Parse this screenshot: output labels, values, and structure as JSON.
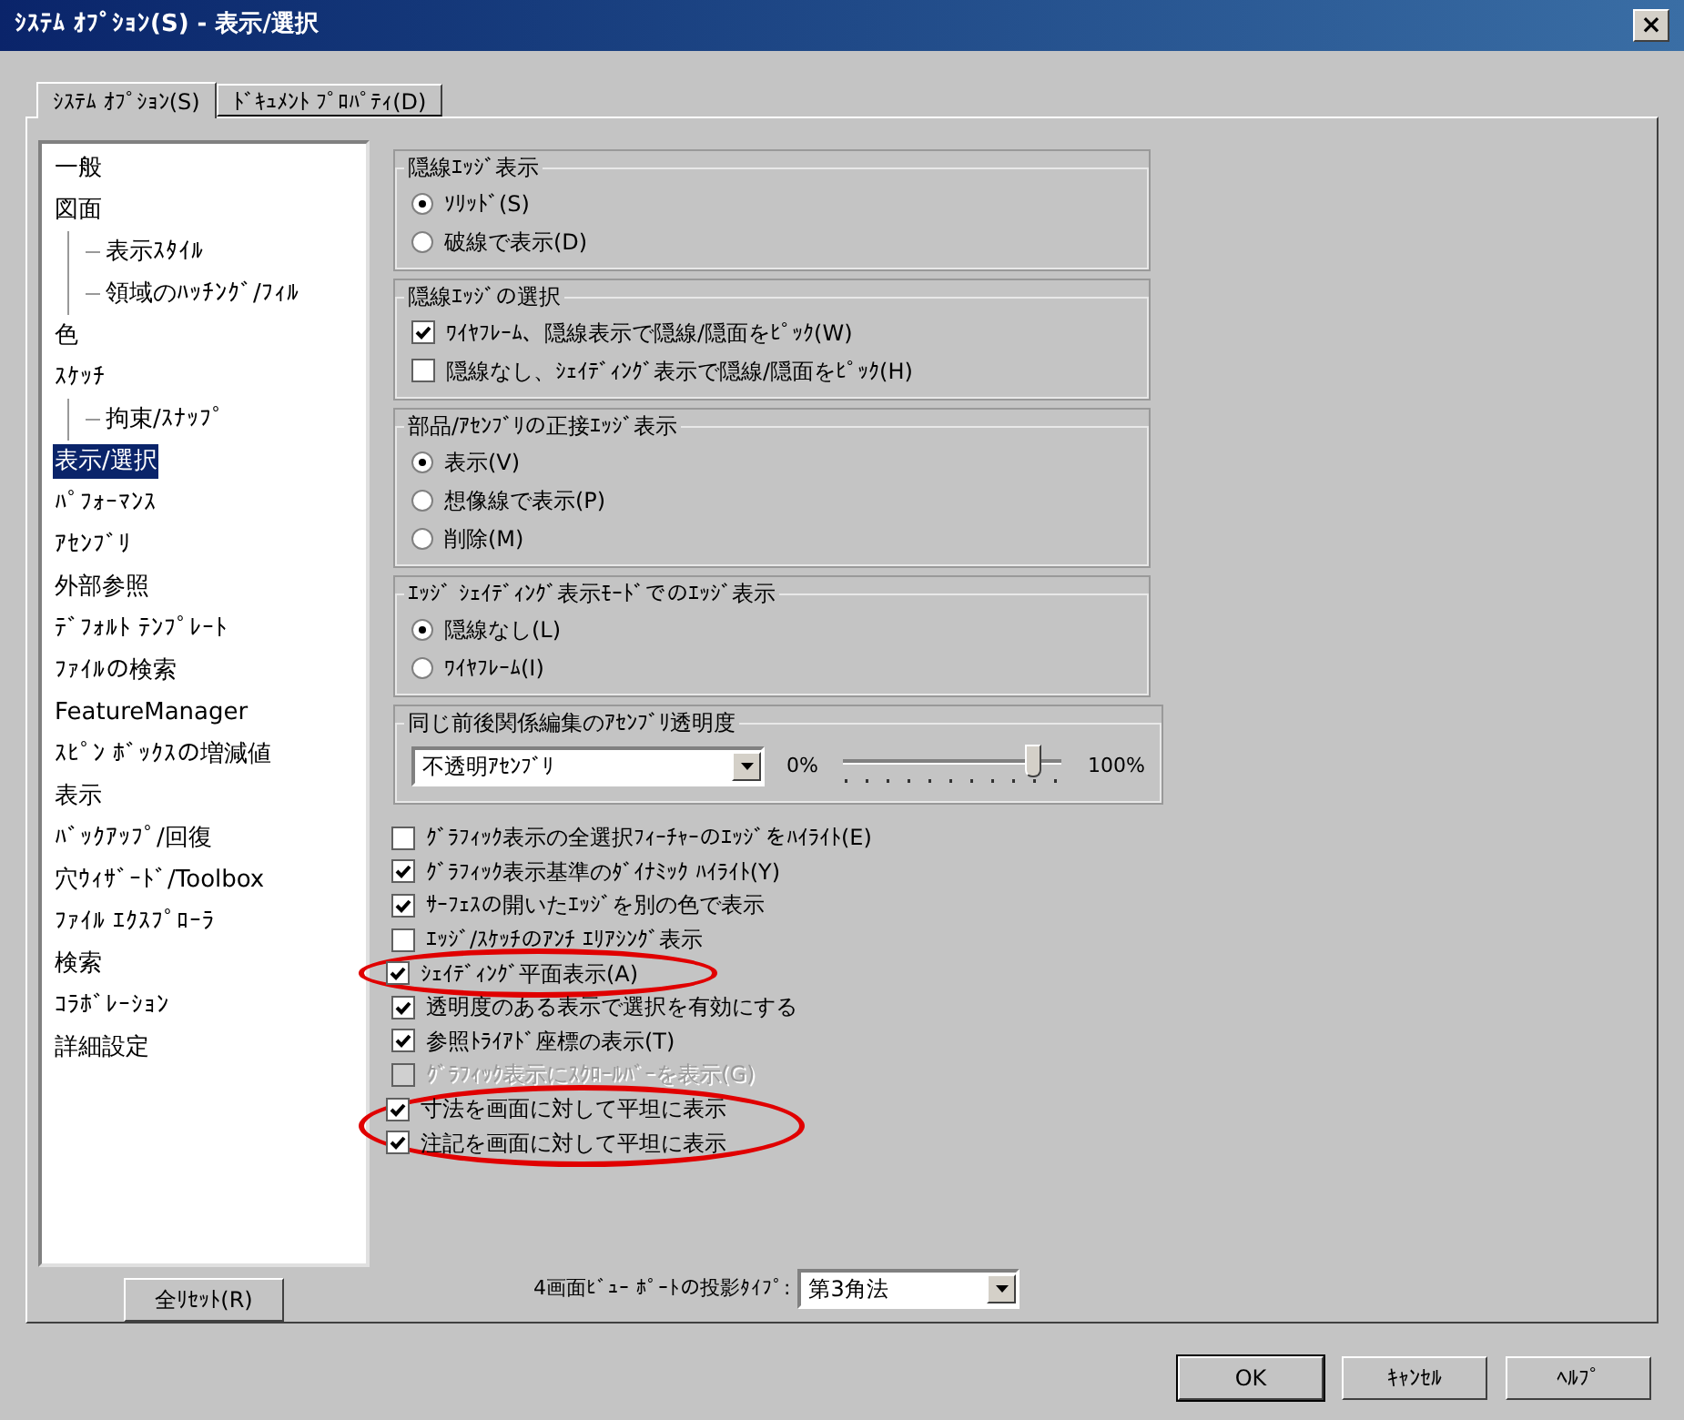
{
  "window": {
    "title": "ｼｽﾃﾑ ｵﾌﾟｼｮﾝ(S) - 表示/選択",
    "close": "×"
  },
  "tabs": [
    {
      "label": "ｼｽﾃﾑ ｵﾌﾟｼｮﾝ(S)",
      "selected": true
    },
    {
      "label": "ﾄﾞｷｭﾒﾝﾄ ﾌﾟﾛﾊﾟﾃｨ(D)",
      "selected": false
    }
  ],
  "sidebar": {
    "items": [
      {
        "label": "一般",
        "selected": false
      },
      {
        "label": "図面",
        "selected": false,
        "children": [
          {
            "label": "表示ｽﾀｲﾙ",
            "selected": false
          },
          {
            "label": "領域のﾊｯﾁﾝｸﾞ/ﾌｨﾙ",
            "selected": false
          }
        ]
      },
      {
        "label": "色",
        "selected": false
      },
      {
        "label": "ｽｹｯﾁ",
        "selected": false,
        "children": [
          {
            "label": "拘束/ｽﾅｯﾌﾟ",
            "selected": false
          }
        ]
      },
      {
        "label": "表示/選択",
        "selected": true
      },
      {
        "label": "ﾊﾟﾌｫｰﾏﾝｽ",
        "selected": false
      },
      {
        "label": "ｱｾﾝﾌﾞﾘ",
        "selected": false
      },
      {
        "label": "外部参照",
        "selected": false
      },
      {
        "label": "ﾃﾞﾌｫﾙﾄ ﾃﾝﾌﾟﾚｰﾄ",
        "selected": false
      },
      {
        "label": "ﾌｧｲﾙの検索",
        "selected": false
      },
      {
        "label": "FeatureManager",
        "selected": false
      },
      {
        "label": "ｽﾋﾟﾝ ﾎﾞｯｸｽの増減値",
        "selected": false
      },
      {
        "label": "表示",
        "selected": false
      },
      {
        "label": "ﾊﾞｯｸｱｯﾌﾟ/回復",
        "selected": false
      },
      {
        "label": "穴ｳｨｻﾞｰﾄﾞ/Toolbox",
        "selected": false
      },
      {
        "label": "ﾌｧｲﾙ ｴｸｽﾌﾟﾛｰﾗ",
        "selected": false
      },
      {
        "label": "検索",
        "selected": false
      },
      {
        "label": "ｺﾗﾎﾞﾚｰｼｮﾝ",
        "selected": false
      },
      {
        "label": "詳細設定",
        "selected": false
      }
    ],
    "reset_button": "全ﾘｾｯﾄ(R)"
  },
  "groups": [
    {
      "kind": "radio",
      "title": "隠線ｴｯｼﾞ表示",
      "options": [
        {
          "label": "ｿﾘｯﾄﾞ(S)",
          "selected": true
        },
        {
          "label": "破線で表示(D)",
          "selected": false
        }
      ]
    },
    {
      "kind": "check",
      "title": "隠線ｴｯｼﾞの選択",
      "options": [
        {
          "label": "ﾜｲﾔﾌﾚｰﾑ、隠線表示で隠線/隠面をﾋﾟｯｸ(W)",
          "checked": true
        },
        {
          "label": "隠線なし、ｼｪｲﾃﾞｨﾝｸﾞ表示で隠線/隠面をﾋﾟｯｸ(H)",
          "checked": false
        }
      ]
    },
    {
      "kind": "radio",
      "title": "部品/ｱｾﾝﾌﾞﾘの正接ｴｯｼﾞ表示",
      "options": [
        {
          "label": "表示(V)",
          "selected": true
        },
        {
          "label": "想像線で表示(P)",
          "selected": false
        },
        {
          "label": "削除(M)",
          "selected": false
        }
      ]
    },
    {
      "kind": "radio",
      "title": "ｴｯｼﾞ ｼｪｲﾃﾞｨﾝｸﾞ表示ﾓｰﾄﾞでのｴｯｼﾞ表示",
      "options": [
        {
          "label": "隠線なし(L)",
          "selected": true
        },
        {
          "label": "ﾜｲﾔﾌﾚｰﾑ(I)",
          "selected": false
        }
      ]
    },
    {
      "kind": "transparency",
      "title": "同じ前後関係編集のｱｾﾝﾌﾞﾘ透明度",
      "dropdown": "不透明ｱｾﾝﾌﾞﾘ",
      "min_label": "0%",
      "max_label": "100%",
      "level": 0.9
    }
  ],
  "options": [
    {
      "label": "ｸﾞﾗﾌｨｯｸ表示の全選択ﾌｨｰﾁｬｰのｴｯｼﾞをﾊｲﾗｲﾄ(E)",
      "checked": false,
      "disabled": false,
      "circled": false
    },
    {
      "label": "ｸﾞﾗﾌｨｯｸ表示基準のﾀﾞｲﾅﾐｯｸ ﾊｲﾗｲﾄ(Y)",
      "checked": true,
      "disabled": false,
      "circled": false
    },
    {
      "label": "ｻｰﾌｪｽの開いたｴｯｼﾞを別の色で表示",
      "checked": true,
      "disabled": false,
      "circled": false
    },
    {
      "label": "ｴｯｼﾞ/ｽｹｯﾁのｱﾝﾁ ｴﾘｱｼﾝｸﾞ表示",
      "checked": false,
      "disabled": false,
      "circled": false
    },
    {
      "label": "ｼｪｲﾃﾞｨﾝｸﾞ平面表示(A)",
      "checked": true,
      "disabled": false,
      "circled": true
    },
    {
      "label": "透明度のある表示で選択を有効にする",
      "checked": true,
      "disabled": false,
      "circled": false
    },
    {
      "label": "参照ﾄﾗｲｱﾄﾞ座標の表示(T)",
      "checked": true,
      "disabled": false,
      "circled": false
    },
    {
      "label": "ｸﾞﾗﾌｨｯｸ表示にｽｸﾛｰﾙﾊﾞｰを表示(G)",
      "checked": false,
      "disabled": true,
      "circled": false
    },
    {
      "label": "寸法を画面に対して平坦に表示",
      "checked": true,
      "disabled": false,
      "circled": true
    },
    {
      "label": "注記を画面に対して平坦に表示",
      "checked": true,
      "disabled": false,
      "circled": true
    }
  ],
  "projection": {
    "label": "4画面ﾋﾞｭｰ ﾎﾟｰﾄの投影ﾀｲﾌﾟ:",
    "value": "第3角法"
  },
  "buttons": [
    "OK",
    "ｷｬﾝｾﾙ",
    "ﾍﾙﾌﾟ"
  ]
}
